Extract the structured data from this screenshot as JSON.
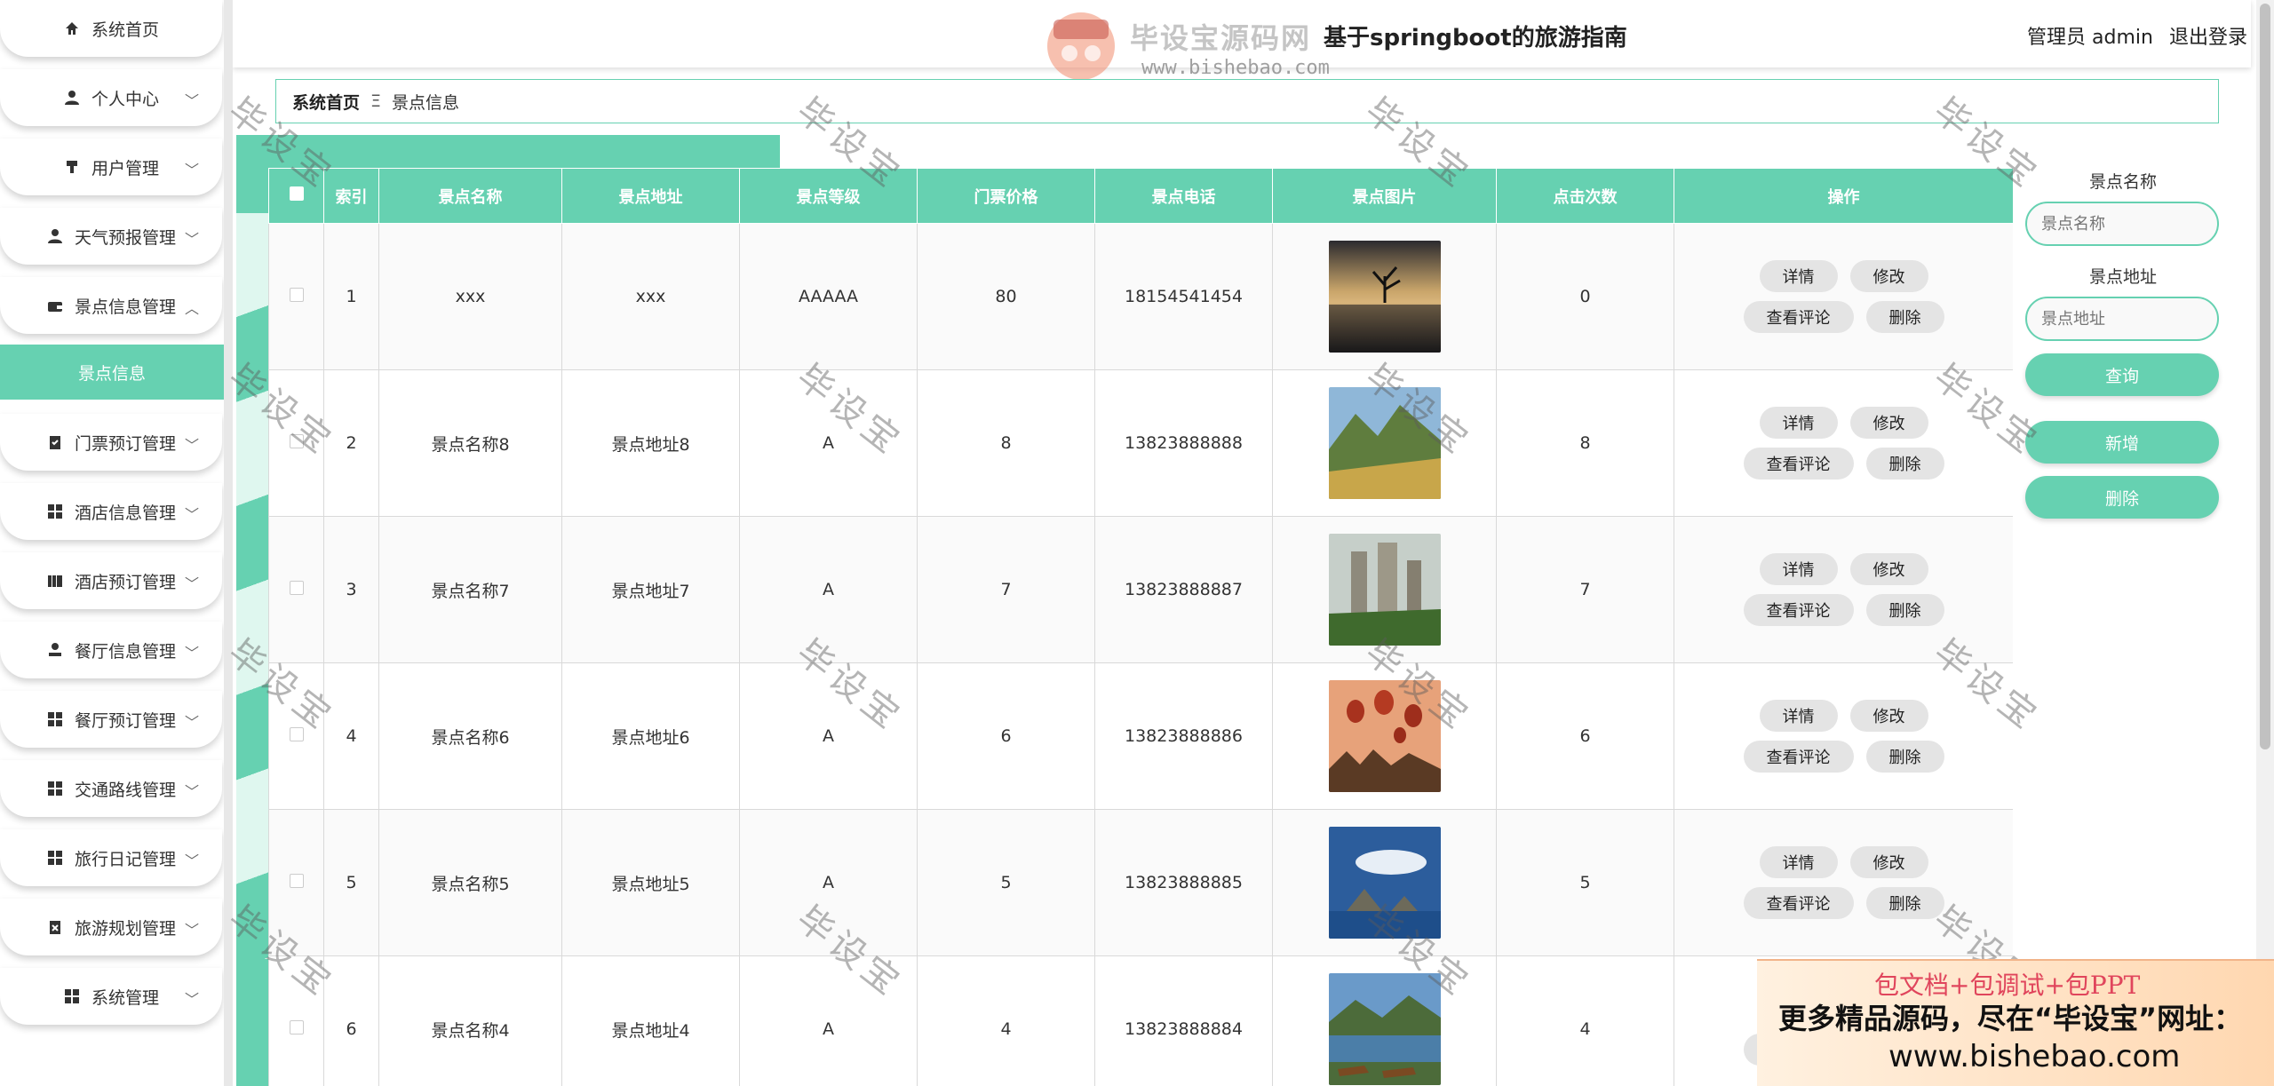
{
  "header": {
    "title": "基于springboot的旅游指南",
    "logo_text": "毕设宝源码网",
    "logo_url": "www.bishebao.com",
    "user_label": "管理员 admin",
    "logout_label": "退出登录"
  },
  "sidebar": {
    "items": [
      {
        "label": "系统首页",
        "icon": "home-icon"
      },
      {
        "label": "个人中心",
        "icon": "user-icon"
      },
      {
        "label": "用户管理",
        "icon": "users-icon"
      },
      {
        "label": "天气预报管理",
        "icon": "user-icon"
      },
      {
        "label": "景点信息管理",
        "icon": "wallet-icon"
      },
      {
        "label": "门票预订管理",
        "icon": "clipboard-icon"
      },
      {
        "label": "酒店信息管理",
        "icon": "grid-icon"
      },
      {
        "label": "酒店预订管理",
        "icon": "book-icon"
      },
      {
        "label": "餐厅信息管理",
        "icon": "person-icon"
      },
      {
        "label": "餐厅预订管理",
        "icon": "grid-icon"
      },
      {
        "label": "交通路线管理",
        "icon": "grid-icon"
      },
      {
        "label": "旅行日记管理",
        "icon": "grid-icon"
      },
      {
        "label": "旅游规划管理",
        "icon": "clipboard-icon"
      },
      {
        "label": "系统管理",
        "icon": "grid-icon"
      }
    ],
    "active_sub": "景点信息"
  },
  "breadcrumb": {
    "home": "系统首页",
    "separator": "Ξ",
    "current": "景点信息"
  },
  "table": {
    "headers": [
      "索引",
      "景点名称",
      "景点地址",
      "景点等级",
      "门票价格",
      "景点电话",
      "景点图片",
      "点击次数",
      "操作"
    ],
    "rows": [
      {
        "index": "1",
        "name": "xxx",
        "address": "xxx",
        "level": "AAAAA",
        "price": "80",
        "phone": "18154541454",
        "clicks": "0",
        "image": "lone-tree-at-lake"
      },
      {
        "index": "2",
        "name": "景点名称8",
        "address": "景点地址8",
        "level": "A",
        "price": "8",
        "phone": "13823888888",
        "clicks": "8",
        "image": "green-mountain-valley"
      },
      {
        "index": "3",
        "name": "景点名称7",
        "address": "景点地址7",
        "level": "A",
        "price": "7",
        "phone": "13823888887",
        "clicks": "7",
        "image": "karst-rock-pillars"
      },
      {
        "index": "4",
        "name": "景点名称6",
        "address": "景点地址6",
        "level": "A",
        "price": "6",
        "phone": "13823888886",
        "clicks": "6",
        "image": "hot-air-balloons"
      },
      {
        "index": "5",
        "name": "景点名称5",
        "address": "景点地址5",
        "level": "A",
        "price": "5",
        "phone": "13823888885",
        "clicks": "5",
        "image": "sea-rocks-blue-sky"
      },
      {
        "index": "6",
        "name": "景点名称4",
        "address": "景点地址4",
        "level": "A",
        "price": "4",
        "phone": "13823888884",
        "clicks": "4",
        "image": "lake-boats-mountains"
      }
    ],
    "actions": {
      "detail": "详情",
      "edit": "修改",
      "comments": "查看评论",
      "delete": "删除"
    }
  },
  "search": {
    "name_label": "景点名称",
    "name_placeholder": "景点名称",
    "address_label": "景点地址",
    "address_placeholder": "景点地址",
    "query_label": "查询",
    "add_label": "新增",
    "delete_label": "删除"
  },
  "watermark": "毕设宝",
  "promo": {
    "line1": "包文档+包调试+包PPT",
    "line2": "更多精品源码，尽在“毕设宝”网址：",
    "line3": "www.bishebao.com"
  },
  "colors": {
    "accent": "#66d1b1",
    "button_gray": "#e4e4e4"
  }
}
